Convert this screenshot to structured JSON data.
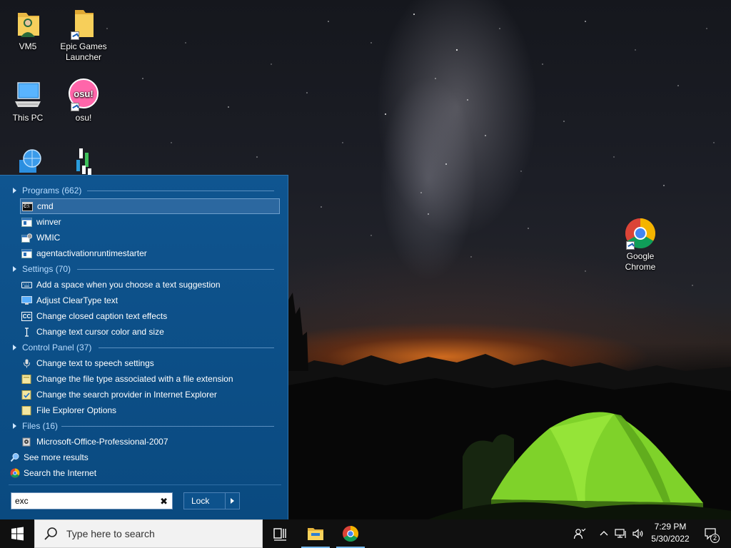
{
  "desktop": {
    "icons": [
      {
        "label": "VM5"
      },
      {
        "label": "Epic Games Launcher"
      },
      {
        "label": "This PC"
      },
      {
        "label": "osu!"
      },
      {
        "label": "Google Chrome"
      }
    ],
    "osu_badge": "osu!"
  },
  "search_panel": {
    "sections": [
      {
        "label": "Programs (662)"
      },
      {
        "label": "Settings (70)"
      },
      {
        "label": "Control Panel (37)"
      },
      {
        "label": "Files (16)"
      }
    ],
    "programs": [
      "cmd",
      "winver",
      "WMIC",
      "agentactivationruntimestarter"
    ],
    "settings": [
      "Add a space when you choose a text suggestion",
      "Adjust ClearType text",
      "Change closed caption text effects",
      "Change text cursor color and size"
    ],
    "control_panel": [
      "Change text to speech settings",
      "Change the file type associated with a file extension",
      "Change the search provider in Internet Explorer",
      "File Explorer Options"
    ],
    "files": [
      "Microsoft-Office-Professional-2007"
    ],
    "see_more": "See more results",
    "search_internet": "Search the Internet",
    "query": "exc",
    "power_button": "Lock",
    "cc_badge": "CC",
    "cmd_badge": "C:\\"
  },
  "taskbar": {
    "search_placeholder": "Type here to search",
    "time": "7:29 PM",
    "date": "5/30/2022",
    "notifications_count": "2"
  },
  "colors": {
    "panel": "#0c4e86",
    "section_text": "#b8dcff",
    "taskbar": "#101010",
    "accent": "#76b9ed"
  }
}
